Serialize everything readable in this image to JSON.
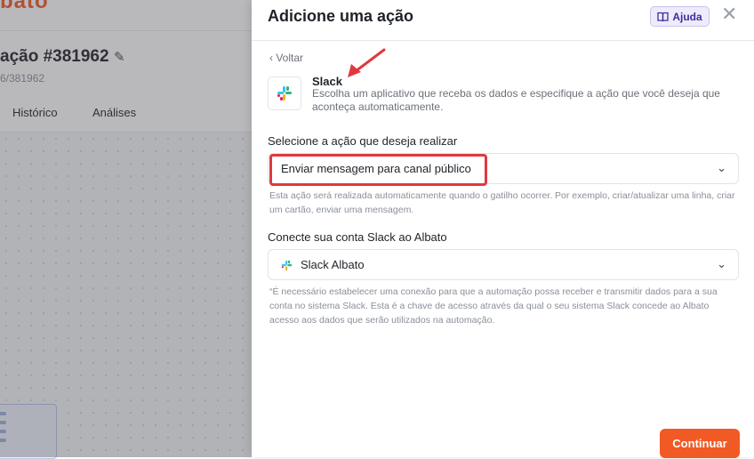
{
  "background": {
    "logo_text": "bato",
    "automation_title": "ação #381962",
    "automation_sub": "6/381962",
    "tabs": [
      "Histórico",
      "Análises"
    ],
    "pencil_icon": "pencil-icon"
  },
  "drawer": {
    "title": "Adicione uma ação",
    "help_label": "Ajuda",
    "help_icon": "book-icon",
    "close_icon": "close-icon",
    "back_label": "Voltar",
    "app": {
      "name": "Slack",
      "icon": "slack-icon",
      "description": "Escolha um aplicativo que receba os dados e especifique a ação que você deseja que aconteça automaticamente."
    },
    "action_section": {
      "label": "Selecione a ação que deseja realizar",
      "selected_value": "Enviar mensagem para canal público",
      "hint": "Esta ação será realizada automaticamente quando o gatilho ocorrer. Por exemplo, criar/atualizar uma linha, criar um cartão, enviar uma mensagem."
    },
    "account_section": {
      "label": "Conecte sua conta Slack ao Albato",
      "selected_value": "Slack Albato",
      "hint": "“É necessário estabelecer uma conexão para que a automação possa receber e transmitir dados para a sua conta no sistema Slack. Esta é a chave de acesso através da qual o seu sistema Slack concede ao Albato acesso aos dados que serão utilizados na automação."
    },
    "continue_label": "Continuar"
  },
  "colors": {
    "brand_orange": "#f15a24",
    "annotation_red": "#e0393e",
    "help_purple": "#3c2f9e"
  }
}
